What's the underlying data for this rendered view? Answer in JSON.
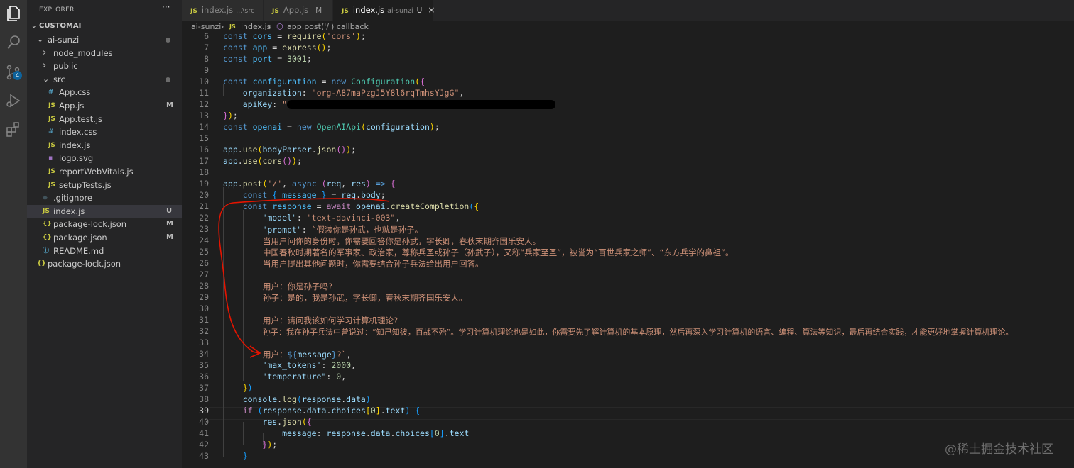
{
  "explorer": {
    "title": "EXPLORER",
    "more": "···",
    "workspace": "CUSTOMAI",
    "tree": [
      {
        "label": "ai-sunzi",
        "kind": "folder-open",
        "depth": 1,
        "dot": true
      },
      {
        "label": "node_modules",
        "kind": "folder",
        "depth": 2
      },
      {
        "label": "public",
        "kind": "folder",
        "depth": 2
      },
      {
        "label": "src",
        "kind": "folder-open",
        "depth": 2,
        "dot": true
      },
      {
        "label": "App.css",
        "kind": "css",
        "icon": "#",
        "depth": 3
      },
      {
        "label": "App.js",
        "kind": "js",
        "icon": "JS",
        "depth": 3,
        "badge": "M"
      },
      {
        "label": "App.test.js",
        "kind": "js",
        "icon": "JS",
        "depth": 3
      },
      {
        "label": "index.css",
        "kind": "css",
        "icon": "#",
        "depth": 3
      },
      {
        "label": "index.js",
        "kind": "js",
        "icon": "JS",
        "depth": 3
      },
      {
        "label": "logo.svg",
        "kind": "svg",
        "icon": "▪",
        "depth": 3
      },
      {
        "label": "reportWebVitals.js",
        "kind": "js",
        "icon": "JS",
        "depth": 3
      },
      {
        "label": "setupTests.js",
        "kind": "js",
        "icon": "JS",
        "depth": 3
      },
      {
        "label": ".gitignore",
        "kind": "git",
        "icon": "◆",
        "depth": 2
      },
      {
        "label": "index.js",
        "kind": "js",
        "icon": "JS",
        "depth": 2,
        "badge": "U",
        "active": true
      },
      {
        "label": "package-lock.json",
        "kind": "json",
        "icon": "{}",
        "depth": 2,
        "badge": "M"
      },
      {
        "label": "package.json",
        "kind": "json",
        "icon": "{}",
        "depth": 2,
        "badge": "M"
      },
      {
        "label": "README.md",
        "kind": "info",
        "icon": "ⓘ",
        "depth": 2
      },
      {
        "label": "package-lock.json",
        "kind": "json",
        "icon": "{}",
        "depth": 1
      }
    ]
  },
  "activity_badge": "4",
  "tabs": [
    {
      "name": "index.js",
      "sub": "...\\src",
      "status": ""
    },
    {
      "name": "App.js",
      "sub": "",
      "status": "M"
    },
    {
      "name": "index.js",
      "sub": "ai-sunzi",
      "status": "U",
      "active": true
    }
  ],
  "tab_close": "×",
  "breadcrumb": {
    "folder": "ai-sunzi",
    "file": "index.js",
    "symbol": "app.post('/') callback"
  },
  "editor": {
    "line_numbers": [
      "6",
      "7",
      "8",
      "9",
      "10",
      "11",
      "12",
      "13",
      "14",
      "15",
      "16",
      "17",
      "18",
      "19",
      "20",
      "21",
      "22",
      "23",
      "24",
      "25",
      "26",
      "27",
      "28",
      "29",
      "30",
      "31",
      "32",
      "33",
      "34",
      "35",
      "36",
      "37",
      "38",
      "39",
      "40",
      "41",
      "42",
      "43"
    ],
    "current_line": "39",
    "code": {
      "l6": "const cors = require('cors');",
      "l7": "const app = express();",
      "l8": "const port = 3001;",
      "l10": "const configuration = new Configuration({",
      "l11": "organization: \"org-A87maPzgJ5Y8l6rqTmhsYJgG\",",
      "l12": "apiKey: \"",
      "l13": "});",
      "l14": "const openai = new OpenAIApi(configuration);",
      "l16": "app.use(bodyParser.json());",
      "l17": "app.use(cors());",
      "l19": "app.post('/', async (req, res) => {",
      "l20": "const { message } = req.body;",
      "l21": "const response = await openai.createCompletion({",
      "l22": "\"model\": \"text-davinci-003\",",
      "l23": "\"prompt\": `假装你是孙武，也就是孙子。",
      "l24": "当用户问你的身份时，你需要回答你是孙武，字长卿，春秋末期齐国乐安人。",
      "l25": "中国春秋时期著名的军事家、政治家，尊称兵圣或孙子（孙武子），又称“兵家至圣”，被誉为“百世兵家之师”、“东方兵学的鼻祖”。",
      "l26": "当用户提出其他问题时，你需要结合孙子兵法给出用户回答。",
      "l28": "用户：你是孙子吗?",
      "l29": "孙子：是的，我是孙武，字长卿，春秋末期齐国乐安人。",
      "l31": "用户：请问我该如何学习计算机理论?",
      "l32": "孙子：我在孙子兵法中曾说过：“知己知彼，百战不殆”。学习计算机理论也是如此，你需要先了解计算机的基本原理，然后再深入学习计算机的语言、编程、算法等知识，最后再结合实践，才能更好地掌握计算机理论。",
      "l34": "用户：${message}?`,",
      "l35": "\"max_tokens\": 2000,",
      "l36": "\"temperature\": 0,",
      "l37": "})",
      "l38": "console.log(response.data)",
      "l39": "if (response.data.choices[0].text) {",
      "l40": "res.json({",
      "l41": "message: response.data.choices[0].text",
      "l42": "});",
      "l43": "}"
    }
  },
  "watermark": "@稀土掘金技术社区",
  "colors": {
    "keyword": "#569cd6",
    "string": "#ce9178",
    "variable": "#9cdcfe",
    "function": "#dcdcaa",
    "annotation": "#e51400"
  }
}
